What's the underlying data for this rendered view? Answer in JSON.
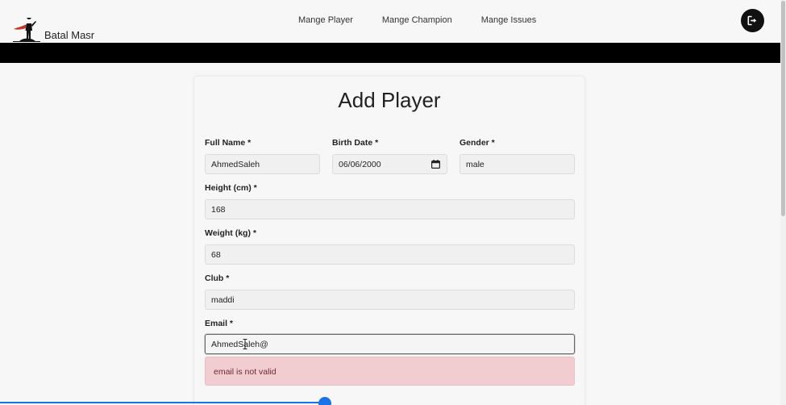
{
  "brand": {
    "name": "Batal Masr",
    "logo_icon": "superhero-logo-icon"
  },
  "nav": {
    "links": [
      {
        "label": "Mange Player"
      },
      {
        "label": "Mange Champion"
      },
      {
        "label": "Mange Issues"
      }
    ],
    "logout_icon": "logout-icon"
  },
  "form": {
    "title": "Add Player",
    "full_name": {
      "label": "Full Name *",
      "value": "AhmedSaleh"
    },
    "birth_date": {
      "label": "Birth Date *",
      "value": "06/06/2000"
    },
    "gender": {
      "label": "Gender *",
      "value": "male"
    },
    "height": {
      "label": "Height (cm) *",
      "value": "168"
    },
    "weight": {
      "label": "Weight (kg) *",
      "value": "68"
    },
    "club": {
      "label": "Club *",
      "value": "maddi"
    },
    "email": {
      "label": "Email *",
      "value": "AhmedSaleh@"
    },
    "email_error": "email is not valid"
  },
  "colors": {
    "navbar_bar": "#000000",
    "error_bg": "#f1cdd1",
    "progress": "#1a73e8"
  }
}
